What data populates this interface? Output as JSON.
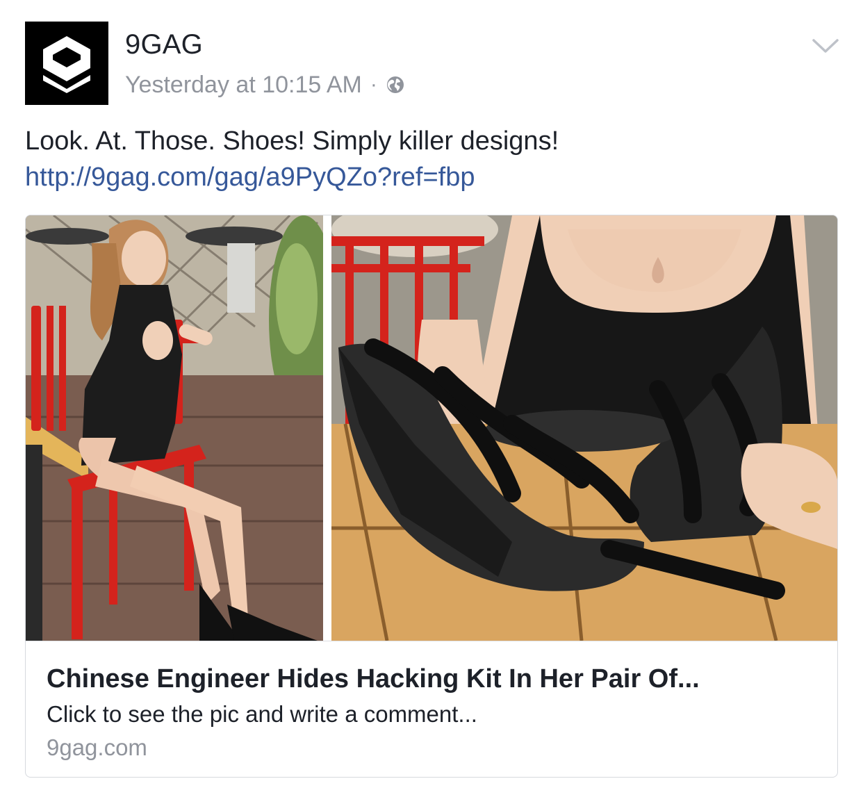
{
  "post": {
    "page_name": "9GAG",
    "timestamp": "Yesterday at 10:15 AM",
    "separator": "·",
    "privacy_icon": "globe-icon",
    "menu_icon": "chevron-down-icon",
    "avatar_icon": "9gag-logo",
    "text": "Look. At. Those. Shoes! Simply killer designs!",
    "link": "http://9gag.com/gag/a9PyQZo?ref=fbp"
  },
  "card": {
    "images": [
      "photo-woman-seated",
      "photo-shoes-on-table"
    ],
    "title": "Chinese Engineer Hides Hacking Kit In Her Pair Of...",
    "description": "Click to see the pic and write a comment...",
    "domain": "9gag.com"
  },
  "colors": {
    "text": "#1d2129",
    "meta": "#90949c",
    "link": "#365899",
    "avatar_bg": "#000000",
    "border": "#d6d9de"
  }
}
